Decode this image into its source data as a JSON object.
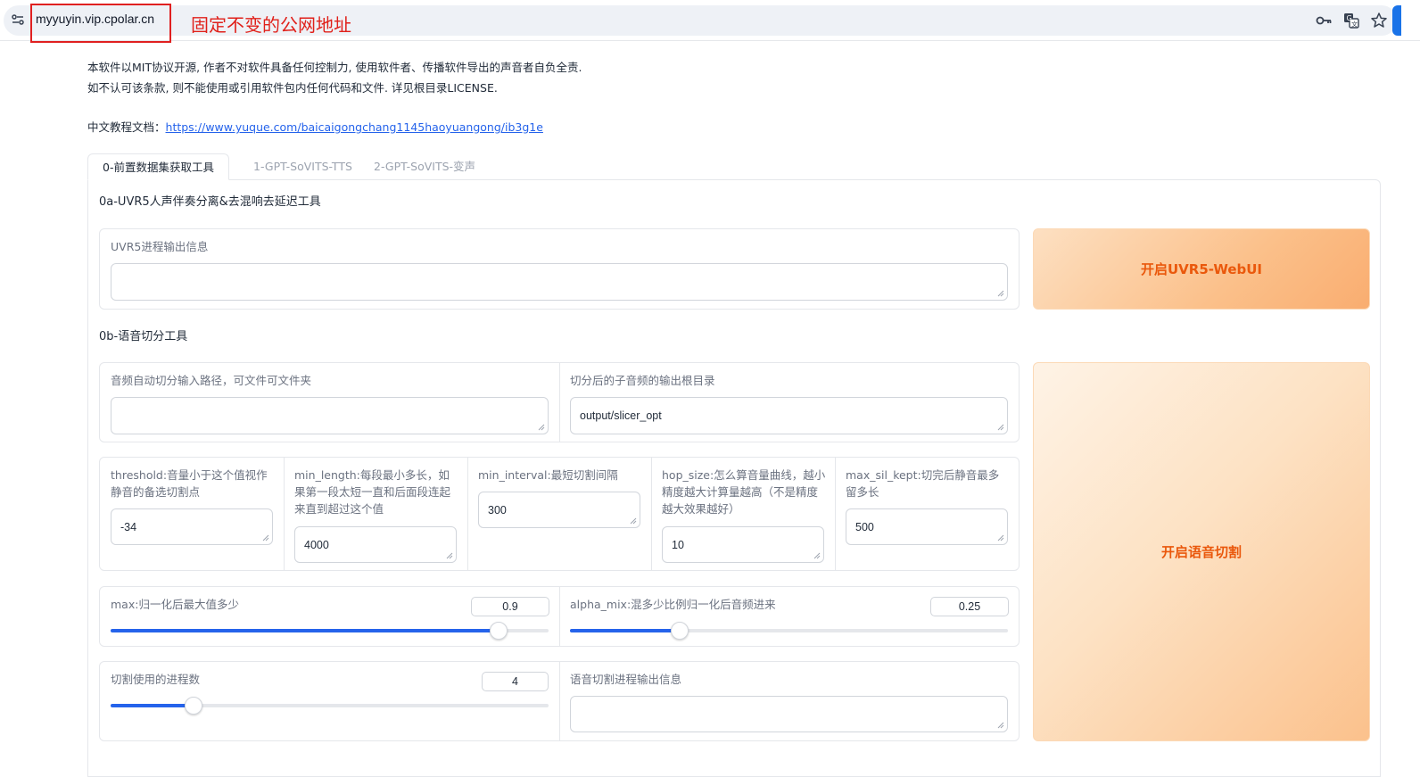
{
  "browser": {
    "url": "myyuyin.vip.cpolar.cn",
    "annotation": "固定不变的公网地址",
    "icons": [
      "site-info-icon",
      "key-icon",
      "translate-icon",
      "star-icon"
    ]
  },
  "notice": {
    "line1": "本软件以MIT协议开源, 作者不对软件具备任何控制力, 使用软件者、传播软件导出的声音者自负全责.",
    "line2": "如不认可该条款, 则不能使用或引用软件包内任何代码和文件. 详见根目录LICENSE."
  },
  "docs": {
    "label": "中文教程文档：",
    "link": "https://www.yuque.com/baicaigongchang1145haoyuangong/ib3g1e"
  },
  "tabs": [
    {
      "label": "0-前置数据集获取工具",
      "active": true
    },
    {
      "label": "1-GPT-SoVITS-TTS",
      "active": false
    },
    {
      "label": "2-GPT-SoVITS-变声",
      "active": false
    }
  ],
  "uvr": {
    "title": "0a-UVR5人声伴奏分离&去混响去延迟工具",
    "output_label": "UVR5进程输出信息",
    "output_value": "",
    "button": "开启UVR5-WebUI"
  },
  "slicer": {
    "title": "0b-语音切分工具",
    "input_label": "音频自动切分输入路径，可文件可文件夹",
    "input_value": "",
    "output_label": "切分后的子音频的输出根目录",
    "output_value": "output/slicer_opt",
    "threshold_label": "threshold:音量小于这个值视作静音的备选切割点",
    "threshold_value": "-34",
    "min_length_label": "min_length:每段最小多长，如果第一段太短一直和后面段连起来直到超过这个值",
    "min_length_value": "4000",
    "min_interval_label": "min_interval:最短切割间隔",
    "min_interval_value": "300",
    "hop_size_label": "hop_size:怎么算音量曲线，越小精度越大计算量越高（不是精度越大效果越好）",
    "hop_size_value": "10",
    "max_sil_kept_label": "max_sil_kept:切完后静音最多留多长",
    "max_sil_kept_value": "500",
    "max_label": "max:归一化后最大值多少",
    "max_value": "0.9",
    "max_fraction": 0.885,
    "alpha_label": "alpha_mix:混多少比例归一化后音频进来",
    "alpha_value": "0.25",
    "alpha_fraction": 0.25,
    "procs_label": "切割使用的进程数",
    "procs_value": "4",
    "procs_fraction": 0.19,
    "log_label": "语音切割进程输出信息",
    "log_value": "",
    "button": "开启语音切割"
  },
  "colors": {
    "accent": "#2563eb",
    "button_text": "#ea580c",
    "annotation": "#e0201a"
  }
}
